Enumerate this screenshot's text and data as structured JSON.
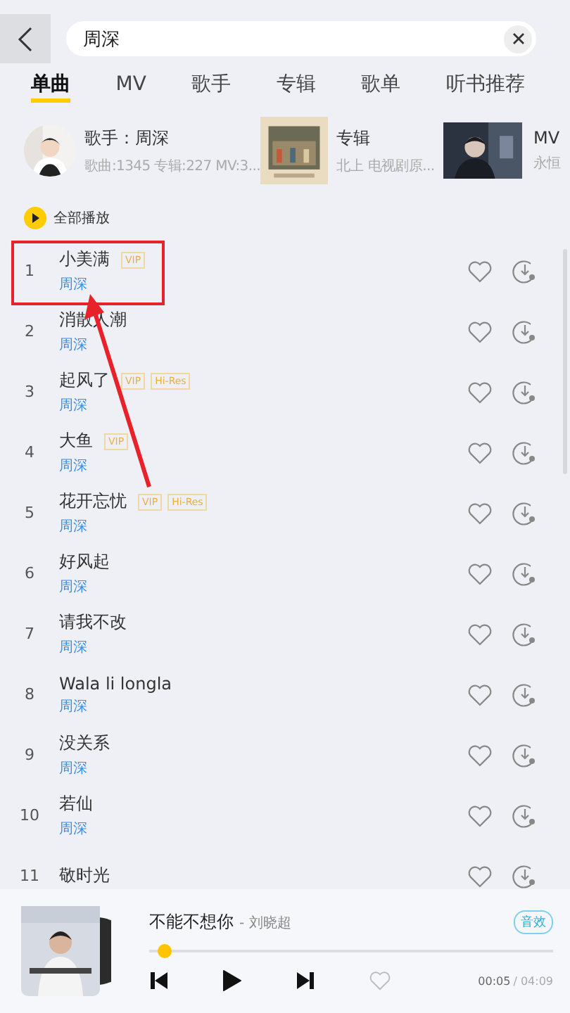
{
  "search": {
    "value": "周深"
  },
  "tabs": [
    {
      "label": "单曲",
      "selected": true
    },
    {
      "label": "MV",
      "selected": false
    },
    {
      "label": "歌手",
      "selected": false
    },
    {
      "label": "专辑",
      "selected": false
    },
    {
      "label": "歌单",
      "selected": false
    },
    {
      "label": "听书推荐",
      "selected": false
    }
  ],
  "top_results": [
    {
      "kind": "artist",
      "title": "歌手：周深",
      "subtitle": "歌曲:1345  专辑:227  MV:3..."
    },
    {
      "kind": "album",
      "title": "专辑",
      "subtitle": "北上 电视剧原..."
    },
    {
      "kind": "mv",
      "title": "MV",
      "subtitle": "永恒"
    }
  ],
  "play_all": "全部播放",
  "songs": [
    {
      "index": "1",
      "title": "小美满",
      "artist": "周深",
      "badges": [
        "VIP"
      ]
    },
    {
      "index": "2",
      "title": "消散人潮",
      "artist": "周深"
    },
    {
      "index": "3",
      "title": "起风了",
      "artist": "周深",
      "badges": [
        "VIP",
        "Hi-Res"
      ]
    },
    {
      "index": "4",
      "title": "大鱼",
      "artist": "周深",
      "badges": [
        "VIP"
      ]
    },
    {
      "index": "5",
      "title": "花开忘忧",
      "artist": "周深",
      "badges": [
        "VIP",
        "Hi-Res"
      ]
    },
    {
      "index": "6",
      "title": "好风起",
      "artist": "周深"
    },
    {
      "index": "7",
      "title": "请我不改",
      "artist": "周深"
    },
    {
      "index": "8",
      "title": "Wala li longla",
      "artist": "周深"
    },
    {
      "index": "9",
      "title": "没关系",
      "artist": "周深"
    },
    {
      "index": "10",
      "title": "若仙",
      "artist": "周深"
    },
    {
      "index": "11",
      "title": "敬时光"
    }
  ],
  "now_playing": {
    "title": "不能不想你",
    "artist": "- 刘晓超",
    "effect": "音效",
    "level": 0.02,
    "elapsed": "00:05",
    "total": "/ 04:09"
  }
}
